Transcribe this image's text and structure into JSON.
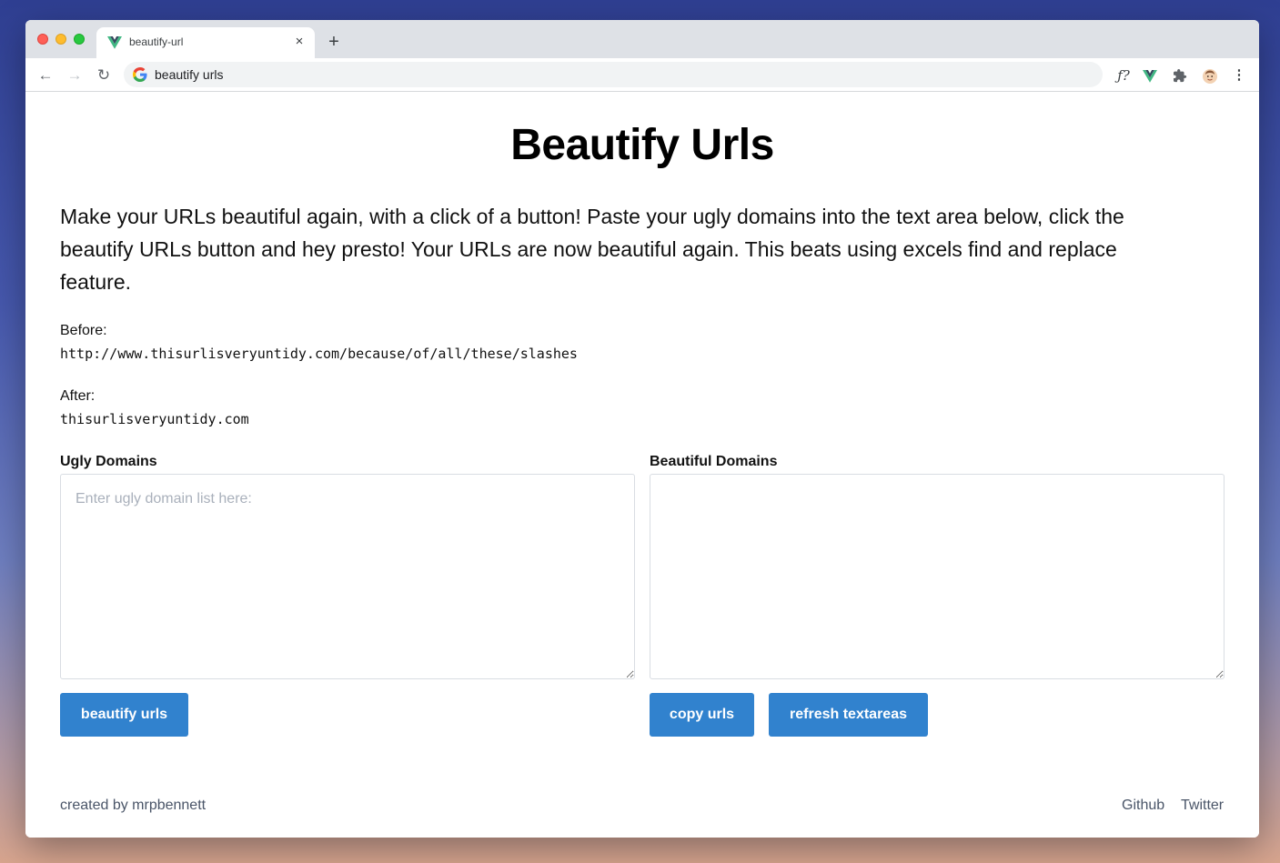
{
  "browser": {
    "tab_title": "beautify-url",
    "tab_close": "×",
    "new_tab": "+",
    "address": "beautify urls",
    "extension_fx": "ƒ?",
    "back": "←",
    "forward": "→",
    "reload": "↻",
    "menu": "⋮"
  },
  "page": {
    "title": "Beautify Urls",
    "intro": "Make your URLs beautiful again, with a click of a button! Paste your ugly domains into the text area below, click the beautify URLs button and hey presto! Your URLs are now beautiful again. This beats using excels find and replace feature.",
    "before_label": "Before:",
    "before_example": "http://www.thisurlisveryuntidy.com/because/of/all/these/slashes",
    "after_label": "After:",
    "after_example": "thisurlisveryuntidy.com",
    "ugly_label": "Ugly Domains",
    "ugly_placeholder": "Enter ugly domain list here:",
    "ugly_value": "",
    "beautiful_label": "Beautiful Domains",
    "beautiful_value": "",
    "beautify_button": "beautify urls",
    "copy_button": "copy urls",
    "refresh_button": "refresh textareas"
  },
  "footer": {
    "credit": "created by mrpbennett",
    "links": [
      "Github",
      "Twitter"
    ]
  },
  "colors": {
    "accent": "#3182ce",
    "vue_green": "#41b883",
    "vue_dark": "#35495e"
  }
}
